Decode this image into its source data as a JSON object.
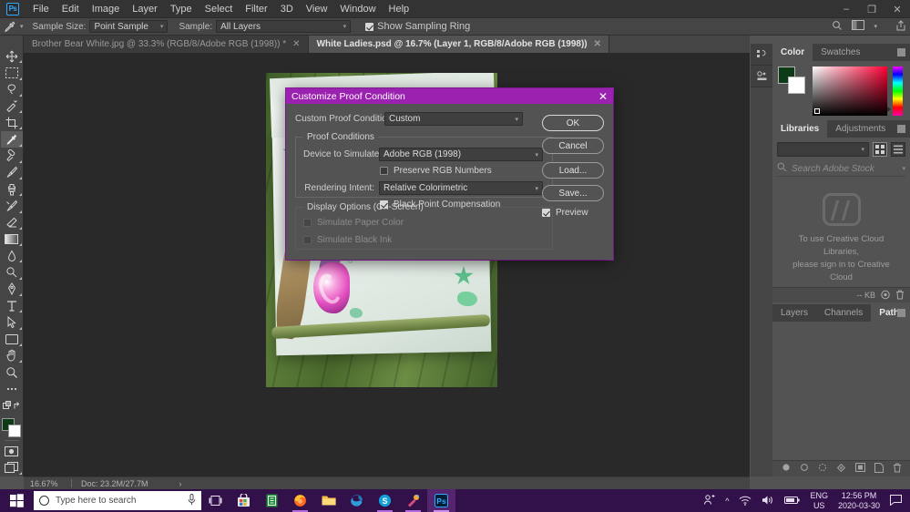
{
  "menubar": {
    "logo": "Ps",
    "items": [
      "File",
      "Edit",
      "Image",
      "Layer",
      "Type",
      "Select",
      "Filter",
      "3D",
      "View",
      "Window",
      "Help"
    ],
    "window_controls": [
      "–",
      "❐",
      "✕"
    ]
  },
  "optionsbar": {
    "tool_icon": "eyedropper-icon",
    "sample_size_label": "Sample Size:",
    "sample_size_value": "Point Sample",
    "sample_label": "Sample:",
    "sample_value": "All Layers",
    "show_sampling_ring_label": "Show Sampling Ring",
    "show_sampling_ring_checked": true,
    "right_icons": [
      "search-icon",
      "workspace-icon",
      "share-icon"
    ]
  },
  "tabs": [
    {
      "label": "Brother Bear White.jpg @ 33.3% (RGB/8/Adobe RGB (1998)) *",
      "close": "✕",
      "active": false
    },
    {
      "label": "White Ladies.psd @ 16.7% (Layer 1, RGB/8/Adobe RGB (1998))",
      "close": "✕",
      "active": true
    }
  ],
  "toolbar": {
    "tools": [
      {
        "name": "move-tool",
        "selected": false
      },
      {
        "name": "rectangular-marquee-tool",
        "selected": false
      },
      {
        "name": "lasso-tool",
        "selected": false
      },
      {
        "name": "quick-selection-tool",
        "selected": false
      },
      {
        "name": "crop-tool",
        "selected": false
      },
      {
        "name": "eyedropper-tool",
        "selected": true
      },
      {
        "name": "spot-healing-brush-tool",
        "selected": false
      },
      {
        "name": "brush-tool",
        "selected": false
      },
      {
        "name": "clone-stamp-tool",
        "selected": false
      },
      {
        "name": "history-brush-tool",
        "selected": false
      },
      {
        "name": "eraser-tool",
        "selected": false
      },
      {
        "name": "gradient-tool",
        "selected": false
      },
      {
        "name": "blur-tool",
        "selected": false
      },
      {
        "name": "dodge-tool",
        "selected": false
      },
      {
        "name": "pen-tool",
        "selected": false
      },
      {
        "name": "horizontal-type-tool",
        "selected": false
      },
      {
        "name": "path-selection-tool",
        "selected": false
      },
      {
        "name": "rectangle-tool",
        "selected": false
      },
      {
        "name": "hand-tool",
        "selected": false
      },
      {
        "name": "zoom-tool",
        "selected": false
      },
      {
        "name": "edit-toolbar-tool",
        "selected": false
      }
    ],
    "foreground_color": "#0d3a17",
    "background_color": "#ffffff"
  },
  "statusbar": {
    "zoom": "16.67%",
    "doc": "Doc: 23.2M/27.7M",
    "arrow": "›"
  },
  "panels": {
    "color": {
      "tabs": [
        {
          "label": "Color",
          "active": true
        },
        {
          "label": "Swatches",
          "active": false
        }
      ],
      "foreground": "#0d3a17",
      "background": "#ffffff"
    },
    "libraries": {
      "tabs": [
        {
          "label": "Libraries",
          "active": true
        },
        {
          "label": "Adjustments",
          "active": false
        }
      ],
      "select_value": "",
      "search_placeholder": "Search Adobe Stock",
      "empty_line1": "To use Creative Cloud Libraries,",
      "empty_line2": "please sign in to Creative Cloud",
      "footer_size": "-- KB"
    },
    "paths": {
      "tabs": [
        {
          "label": "Layers",
          "active": false
        },
        {
          "label": "Channels",
          "active": false
        },
        {
          "label": "Paths",
          "active": true
        }
      ]
    }
  },
  "dialog": {
    "title": "Customize Proof Condition",
    "close": "✕",
    "custom_proof_condition_label": "Custom Proof Condition:",
    "custom_proof_condition_value": "Custom",
    "proof_conditions_legend": "Proof Conditions",
    "device_to_simulate_label": "Device to Simulate:",
    "device_to_simulate_value": "Adobe RGB (1998)",
    "preserve_rgb_numbers_label": "Preserve RGB Numbers",
    "preserve_rgb_numbers_checked": false,
    "rendering_intent_label": "Rendering Intent:",
    "rendering_intent_value": "Relative Colorimetric",
    "black_point_compensation_label": "Black Point Compensation",
    "black_point_compensation_checked": true,
    "display_options_legend": "Display Options (On-Screen)",
    "simulate_paper_color_label": "Simulate Paper Color",
    "simulate_paper_color_checked": false,
    "simulate_black_ink_label": "Simulate Black Ink",
    "simulate_black_ink_checked": false,
    "buttons": {
      "ok": "OK",
      "cancel": "Cancel",
      "load": "Load...",
      "save": "Save..."
    },
    "preview_label": "Preview",
    "preview_checked": true,
    "accent_color": "#9b21b0"
  },
  "taskbar": {
    "search_placeholder": "Type here to search",
    "apps": [
      "task-view-icon",
      "microsoft-store-icon",
      "notes-app-icon",
      "firefox-icon",
      "file-explorer-icon",
      "edge-icon",
      "skype-icon",
      "paint3d-icon",
      "photoshop-icon"
    ],
    "tray": {
      "people_icon": "people-icon",
      "chevron": "^",
      "wifi_icon": "wifi-icon",
      "volume_icon": "volume-icon",
      "battery_icon": "battery-icon",
      "language_line1": "ENG",
      "language_line2": "US",
      "time": "12:56 PM",
      "date": "2020-03-30",
      "notification_icon": "notification-icon"
    }
  }
}
